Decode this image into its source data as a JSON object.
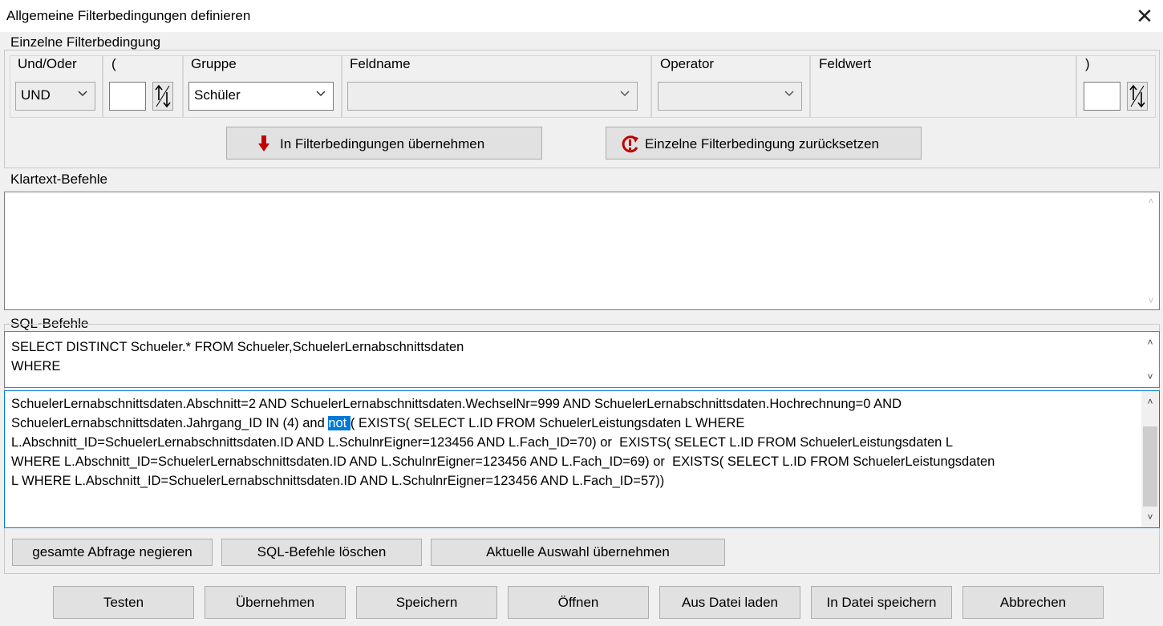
{
  "window": {
    "title": "Allgemeine Filterbedingungen definieren"
  },
  "single": {
    "group_title": "Einzelne Filterbedingung",
    "und_oder": {
      "label": "Und/Oder",
      "value": "UND"
    },
    "open_paren": {
      "label": "(",
      "value": ""
    },
    "gruppe": {
      "label": "Gruppe",
      "value": "Schüler"
    },
    "feldname": {
      "label": "Feldname",
      "value": ""
    },
    "operator": {
      "label": "Operator",
      "value": ""
    },
    "feldwert": {
      "label": "Feldwert"
    },
    "close_paren": {
      "label": ")",
      "value": ""
    },
    "apply_button": "In Filterbedingungen übernehmen",
    "reset_button": "Einzelne Filterbedingung zurücksetzen"
  },
  "klartext": {
    "group_title": "Klartext-Befehle",
    "text": ""
  },
  "sql": {
    "group_title": "SQL-Befehle",
    "head_lines": [
      "SELECT DISTINCT Schueler.* FROM Schueler,SchuelerLernabschnittsdaten",
      "WHERE"
    ],
    "body_lines": [
      "SchuelerLernabschnittsdaten.Abschnitt=2 AND SchuelerLernabschnittsdaten.WechselNr=999 AND SchuelerLernabschnittsdaten.Hochrechnung=0 AND",
      "SchuelerLernabschnittsdaten.Jahrgang_ID IN (4) and ",
      "L.Abschnitt_ID=SchuelerLernabschnittsdaten.ID AND L.SchulnrEigner=123456 AND L.Fach_ID=70) or  EXISTS( SELECT L.ID FROM SchuelerLeistungsdaten L",
      "WHERE L.Abschnitt_ID=SchuelerLernabschnittsdaten.ID AND L.SchulnrEigner=123456 AND L.Fach_ID=69) or  EXISTS( SELECT L.ID FROM SchuelerLeistungsdaten",
      "L WHERE L.Abschnitt_ID=SchuelerLernabschnittsdaten.ID AND L.SchulnrEigner=123456 AND L.Fach_ID=57))"
    ],
    "selected_word": "not ",
    "after_selection": "( EXISTS( SELECT L.ID FROM SchuelerLeistungsdaten L WHERE",
    "negate_button": "gesamte Abfrage negieren",
    "clear_button": "SQL-Befehle löschen",
    "take_selection_button": "Aktuelle Auswahl übernehmen"
  },
  "footer": {
    "test": "Testen",
    "apply": "Übernehmen",
    "save": "Speichern",
    "open": "Öffnen",
    "load_file": "Aus Datei laden",
    "save_file": "In Datei speichern",
    "cancel": "Abbrechen"
  },
  "colors": {
    "selection": "#0078d7",
    "arrow_icon": "#c00000"
  }
}
